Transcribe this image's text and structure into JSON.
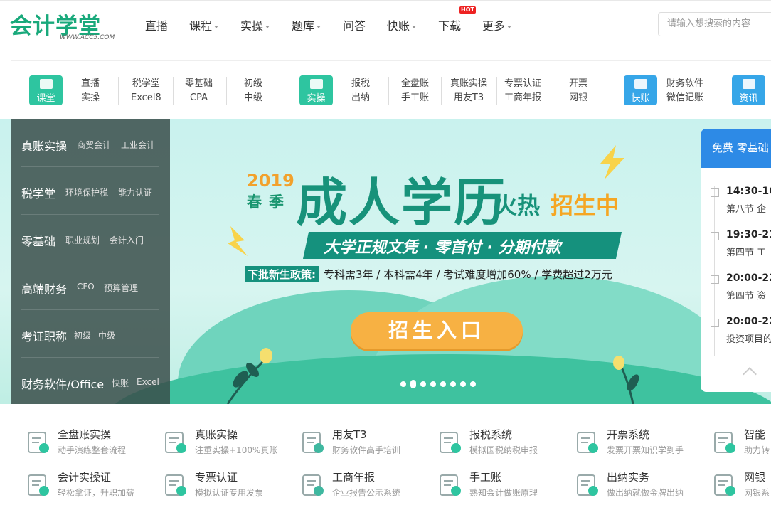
{
  "header": {
    "logo_text": "会计学堂",
    "logo_url": "WWW.ACC5.COM",
    "nav": [
      {
        "label": "直播",
        "dropdown": false
      },
      {
        "label": "课程",
        "dropdown": true
      },
      {
        "label": "实操",
        "dropdown": true
      },
      {
        "label": "题库",
        "dropdown": true
      },
      {
        "label": "问答",
        "dropdown": false
      },
      {
        "label": "快账",
        "dropdown": true
      },
      {
        "label": "下载",
        "dropdown": false
      },
      {
        "label": "更多",
        "dropdown": true
      }
    ],
    "hot_badge": "HOT",
    "search_placeholder": "请输入想搜索的内容"
  },
  "categories": {
    "icons": [
      {
        "label": "课堂",
        "icon": "classroom-icon",
        "color": "#2ec5a0"
      },
      {
        "label": "实操",
        "icon": "practice-icon",
        "color": "#2ec5a0"
      },
      {
        "label": "快账",
        "icon": "bookkeeping-icon",
        "color": "#36a6e8"
      },
      {
        "label": "资讯",
        "icon": "news-icon",
        "color": "#36a6e8"
      }
    ],
    "columns": [
      [
        "直播",
        "实操"
      ],
      [
        "税学堂",
        "Excel8"
      ],
      [
        "零基础",
        "CPA"
      ],
      [
        "初级",
        "中级"
      ],
      [
        "报税",
        "出纳"
      ],
      [
        "全盘账",
        "手工账"
      ],
      [
        "真账实操",
        "用友T3"
      ],
      [
        "专票认证",
        "工商年报"
      ],
      [
        "开票",
        "网银"
      ],
      [
        "财务软件",
        "微信记账"
      ]
    ]
  },
  "sidebar": [
    {
      "main": "真账实操",
      "subs": [
        "商贸会计",
        "工业会计"
      ]
    },
    {
      "main": "税学堂",
      "subs": [
        "环境保护税",
        "能力认证"
      ]
    },
    {
      "main": "零基础",
      "subs": [
        "职业规划",
        "会计入门"
      ]
    },
    {
      "main": "高端财务",
      "subs": [
        "CFO",
        "预算管理"
      ]
    },
    {
      "main": "考证职称",
      "subs": [
        "初级",
        "中级"
      ]
    },
    {
      "main": "财务软件/Office",
      "subs": [
        "快账",
        "Excel"
      ]
    }
  ],
  "banner": {
    "year": "2019",
    "season": "春季",
    "title": "成人学历",
    "hot_a": "火热",
    "hot_b": "招生中",
    "strip": "大学正规文凭 · 零首付 · 分期付款",
    "policy_tag": "下批新生政策:",
    "policy": "专科需3年 / 本科需4年 / 考试难度增加60% / 学费超过2万元",
    "button": "招生入口",
    "slide_count": 8,
    "active_slide": 2
  },
  "live": {
    "header": "免费  零基础",
    "items": [
      {
        "time": "14:30-16",
        "title": "第八节 企"
      },
      {
        "time": "19:30-21",
        "title": "第四节 工"
      },
      {
        "time": "20:00-22",
        "title": "第四节 资"
      },
      {
        "time": "20:00-22",
        "title": "投资项目的"
      }
    ]
  },
  "services": [
    {
      "title": "全盘账实操",
      "sub": "动手演练整套流程",
      "icon": "ledger-icon"
    },
    {
      "title": "真账实操",
      "sub": "注重实操+100%真账",
      "icon": "calculator-icon"
    },
    {
      "title": "用友T3",
      "sub": "财务软件高手培训",
      "icon": "software-icon"
    },
    {
      "title": "报税系统",
      "sub": "模拟国税纳税申报",
      "icon": "tax-bag-icon"
    },
    {
      "title": "开票系统",
      "sub": "发票开票知识学到手",
      "icon": "invoice-icon"
    },
    {
      "title": "智能",
      "sub": "助力转",
      "icon": "monitor-icon"
    },
    {
      "title": "会计实操证",
      "sub": "轻松拿证，升职加薪",
      "icon": "certificate-icon"
    },
    {
      "title": "专票认证",
      "sub": "模拟认证专用发票",
      "icon": "receipt-icon"
    },
    {
      "title": "工商年报",
      "sub": "企业报告公示系统",
      "icon": "seal-icon"
    },
    {
      "title": "手工账",
      "sub": "熟知会计做账原理",
      "icon": "printer-icon"
    },
    {
      "title": "出纳实务",
      "sub": "做出纳就做金牌出纳",
      "icon": "books-icon"
    },
    {
      "title": "网银",
      "sub": "网银系",
      "icon": "bank-icon"
    }
  ]
}
